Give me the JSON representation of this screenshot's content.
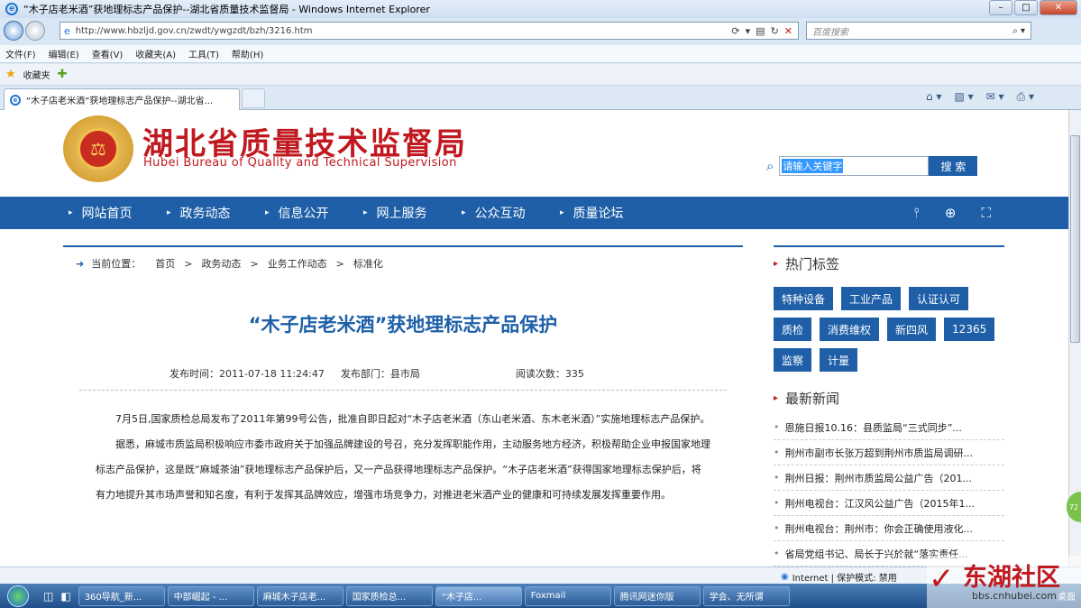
{
  "window": {
    "title": "“木子店老米酒”获地理标志产品保护--湖北省质量技术监督局 - Windows Internet Explorer",
    "min": "–",
    "max": "□",
    "close": "✕"
  },
  "address": {
    "url": "http://www.hbzljd.gov.cn/zwdt/ywgzdt/bzh/3216.htm",
    "search_placeholder": "百度搜索"
  },
  "menu": [
    "文件(F)",
    "编辑(E)",
    "查看(V)",
    "收藏夹(A)",
    "工具(T)",
    "帮助(H)"
  ],
  "favorites": {
    "label": "收藏夹"
  },
  "tab": {
    "label": "“木子店老米酒”获地理标志产品保护--湖北省..."
  },
  "site": {
    "name_cn": "湖北省质量技术监督局",
    "name_en": "Hubei Bureau of Quality and Technical Supervision",
    "search_placeholder": "请输入关键字",
    "search_button": "搜 索",
    "nav": [
      "网站首页",
      "政务动态",
      "信息公开",
      "网上服务",
      "公众互动",
      "质量论坛"
    ]
  },
  "breadcrumb": {
    "label": "当前位置：",
    "items": [
      "首页",
      "政务动态",
      "业务工作动态",
      "标准化"
    ],
    "sep": ">"
  },
  "article": {
    "title": "“木子店老米酒”获地理标志产品保护",
    "published": "发布时间：2011-07-18 11:24:47",
    "dept": "发布部门：县市局",
    "views": "阅读次数：335",
    "paragraphs": [
      "7月5日,国家质检总局发布了2011年第99号公告，批准自即日起对“木子店老米酒（东山老米酒、东木老米酒）”实施地理标志产品保护。",
      "据悉，麻城市质监局积极响应市委市政府关于加强品牌建设的号召，充分发挥职能作用，主动服务地方经济，积极帮助企业申报国家地理标志产品保护，这是既“麻城茶油”获地理标志产品保护后，又一产品获得地理标志产品保护。“木子店老米酒”获得国家地理标志保护后，将有力地提升其市场声誉和知名度，有利于发挥其品牌效应，增强市场竞争力，对推进老米酒产业的健康和可持续发展发挥重要作用。"
    ]
  },
  "sidebar": {
    "hot_tags_title": "热门标签",
    "tags": [
      "特种设备",
      "工业产品",
      "认证认可",
      "质检",
      "消费维权",
      "新四风",
      "12365",
      "监察",
      "计量"
    ],
    "news_title": "最新新闻",
    "news": [
      "恩施日报10.16：县质监局“三式同步”...",
      "荆州市副市长张万超到荆州市质监局调研...",
      "荆州日报：荆州市质监局公益广告（201...",
      "荆州电视台：江汉风公益广告（2015年1...",
      "荆州电视台：荆州市：你会正确使用液化...",
      "省局党组书记、局长于兴於就“落实责任..."
    ]
  },
  "status": {
    "zone": "Internet | 保护模式: 禁用"
  },
  "taskbar": {
    "tasks": [
      "360导航_新...",
      "中部崛起 - ...",
      "麻城木子店老...",
      "国家质检总...",
      "“木子店...",
      "Foxmail",
      "腾讯网迷你版",
      "学会、无所谓"
    ],
    "desktop": "桌面"
  },
  "watermark": {
    "cn": "东湖社区",
    "en": "bbs.cnhubei.com"
  },
  "badge": "72"
}
